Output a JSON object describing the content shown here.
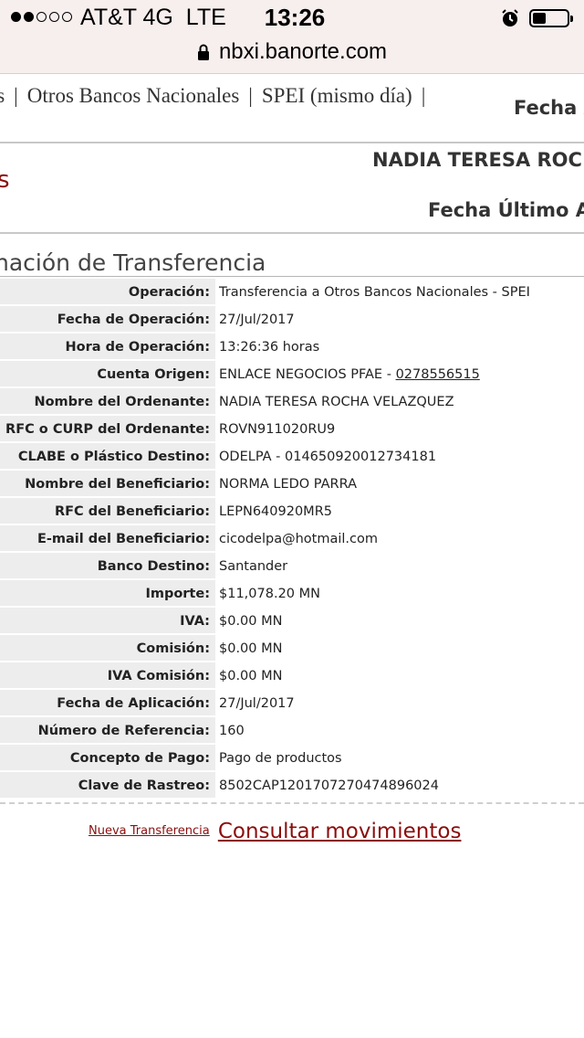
{
  "status_bar": {
    "carrier": "AT&T 4G  LTE",
    "time": "13:26",
    "signal_bars_filled": 2,
    "signal_bars_total": 5,
    "battery_level": 0.4
  },
  "browser": {
    "url": "nbxi.banorte.com",
    "lock_icon": "lock-icon"
  },
  "nav": {
    "items": [
      "as",
      "Otros Bancos Nacionales",
      "SPEI (mismo día)"
    ],
    "separator": "|"
  },
  "header": {
    "fecha_label": "Fecha A",
    "user_name": "NADIA TERESA ROC",
    "red_fragment": "s",
    "fecha_ultimo": "Fecha Último A",
    "section_title": "nación de Transferencia"
  },
  "detail": [
    {
      "label": "Operación:",
      "value": "Transferencia a Otros Bancos Nacionales - SPEI"
    },
    {
      "label": "Fecha de Operación:",
      "value": "27/Jul/2017"
    },
    {
      "label": "Hora de Operación:",
      "value": "13:26:36 horas"
    },
    {
      "label": "Cuenta Origen:",
      "value": "ENLACE NEGOCIOS PFAE - ",
      "link": "0278556515"
    },
    {
      "label": "Nombre del Ordenante:",
      "value": "NADIA TERESA ROCHA VELAZQUEZ"
    },
    {
      "label": "RFC o CURP del Ordenante:",
      "value": "ROVN911020RU9"
    },
    {
      "label": "CLABE o Plástico Destino:",
      "value": "ODELPA - 014650920012734181"
    },
    {
      "label": "Nombre del Beneficiario:",
      "value": "NORMA LEDO PARRA"
    },
    {
      "label": "RFC del Beneficiario:",
      "value": "LEPN640920MR5"
    },
    {
      "label": "E-mail del Beneficiario:",
      "value": "cicodelpa@hotmail.com"
    },
    {
      "label": "Banco Destino:",
      "value": "Santander"
    },
    {
      "label": "Importe:",
      "value": "$11,078.20 MN"
    },
    {
      "label": "IVA:",
      "value": "$0.00 MN"
    },
    {
      "label": "Comisión:",
      "value": "$0.00 MN"
    },
    {
      "label": "IVA Comisión:",
      "value": "$0.00 MN"
    },
    {
      "label": "Fecha de Aplicación:",
      "value": "27/Jul/2017"
    },
    {
      "label": "Número de Referencia:",
      "value": "160"
    },
    {
      "label": "Concepto de Pago:",
      "value": "Pago de productos"
    },
    {
      "label": "Clave de Rastreo:",
      "value": "8502CAP1201707270474896024"
    }
  ],
  "actions": {
    "nueva": "Nueva Transferencia",
    "consultar": "Consultar movimientos"
  },
  "colors": {
    "brand_red": "#8b0d0d",
    "label_bg": "#ededed",
    "chrome_bg": "#f7eeee"
  }
}
